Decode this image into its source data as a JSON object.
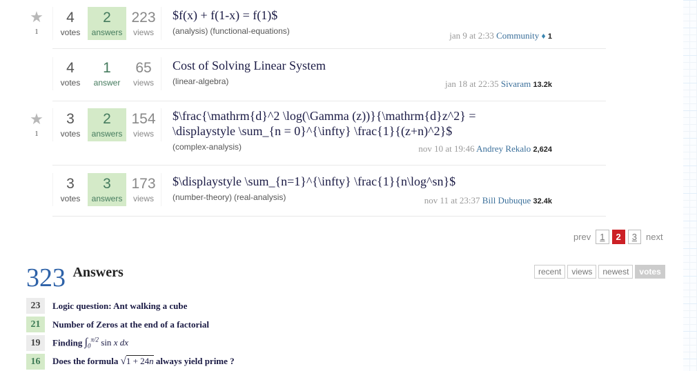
{
  "questions": [
    {
      "favorite_count": "1",
      "votes": "4",
      "votes_label": "votes",
      "answers": "2",
      "answers_label": "answers",
      "accepted": true,
      "views": "223",
      "views_label": "views",
      "title": "$f(x) + f(1-x) = f(1)$",
      "tags": [
        "(analysis)",
        "(functional-equations)"
      ],
      "when": "jan 9 at 2:33",
      "user": "Community",
      "rep": "1",
      "moderator": true,
      "favorited": true
    },
    {
      "favorite_count": "",
      "votes": "4",
      "votes_label": "votes",
      "answers": "1",
      "answers_label": "answer",
      "accepted": false,
      "views": "65",
      "views_label": "views",
      "title": "Cost of Solving Linear System",
      "tags": [
        "(linear-algebra)"
      ],
      "when": "jan 18 at 22:35",
      "user": "Sivaram",
      "rep": "13.2k",
      "moderator": false,
      "favorited": false
    },
    {
      "favorite_count": "1",
      "votes": "3",
      "votes_label": "votes",
      "answers": "2",
      "answers_label": "answers",
      "accepted": true,
      "views": "154",
      "views_label": "views",
      "title_line1": "$\\frac{\\mathrm{d}^2 \\log(\\Gamma (z))}{\\mathrm{d}z^2} =",
      "title_line2": "\\displaystyle \\sum_{n = 0}^{\\infty} \\frac{1}{(z+n)^2}$",
      "tags": [
        "(complex-analysis)"
      ],
      "when": "nov 10 at 19:46",
      "user": "Andrey Rekalo",
      "rep": "2,624",
      "moderator": false,
      "favorited": true
    },
    {
      "favorite_count": "",
      "votes": "3",
      "votes_label": "votes",
      "answers": "3",
      "answers_label": "answers",
      "accepted": true,
      "views": "173",
      "views_label": "views",
      "title": "$\\displaystyle \\sum_{n=1}^{\\infty} \\frac{1}{n\\log^sn}$",
      "tags": [
        "(number-theory)",
        "(real-analysis)"
      ],
      "when": "nov 11 at 23:37",
      "user": "Bill Dubuque",
      "rep": "32.4k",
      "moderator": false,
      "favorited": false
    }
  ],
  "pager": {
    "prev": "prev",
    "next": "next",
    "pages": [
      "1",
      "2",
      "3"
    ],
    "current": "2"
  },
  "answers_section": {
    "count": "323",
    "title": "Answers",
    "sort_tabs": [
      "recent",
      "views",
      "newest",
      "votes"
    ],
    "active_sort": "votes",
    "items": [
      {
        "score": "23",
        "accepted": false,
        "title": "Logic question: Ant walking a cube"
      },
      {
        "score": "21",
        "accepted": true,
        "title": "Number of Zeros at the end of a factorial"
      },
      {
        "score": "19",
        "accepted": false,
        "title_prefix": "Finding",
        "math": "∫₀^{π/2} sin x dx"
      },
      {
        "score": "16",
        "accepted": true,
        "title_prefix": "Does the formula",
        "math": "√(1 + 24n)",
        "title_suffix": "always yield prime ?"
      }
    ]
  },
  "icons": {
    "favorite": "star-icon",
    "moderator": "diamond-icon"
  },
  "colors": {
    "accepted_bg": "#d4eac8",
    "accent_blue": "#2e62a8",
    "pager_current": "#cc2026",
    "user_link": "#3a6f9a"
  }
}
